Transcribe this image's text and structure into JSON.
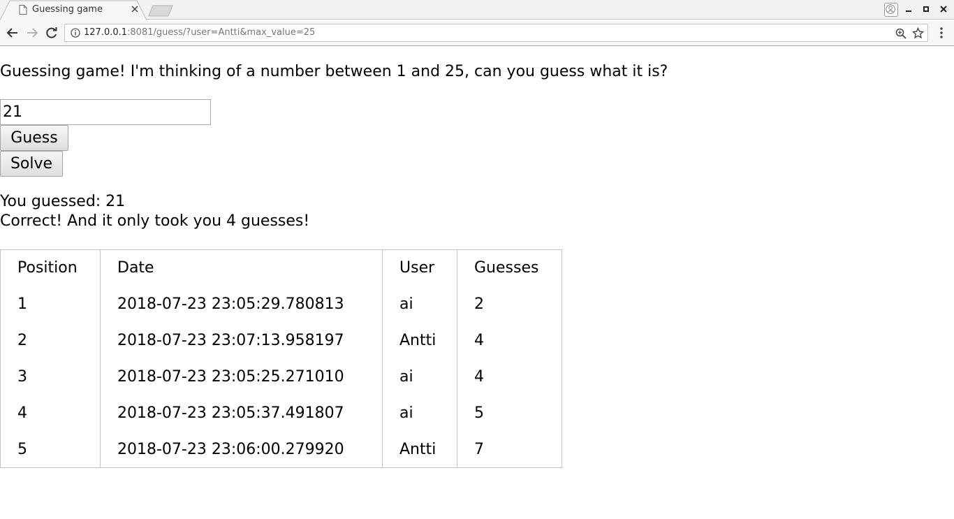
{
  "browser": {
    "tab_title": "Guessing game",
    "url_host": "127.0.0.1",
    "url_rest": ":8081/guess/?user=Antti&max_value=25",
    "icons": [
      "page-icon",
      "close-icon",
      "new-tab-icon",
      "profile-icon",
      "minimize-icon",
      "maximize-icon",
      "window-close-icon",
      "back-icon",
      "forward-icon",
      "reload-icon",
      "info-icon",
      "zoom-icon",
      "star-icon",
      "menu-icon"
    ]
  },
  "page": {
    "intro": "Guessing game! I'm thinking of a number between 1 and 25, can you guess what it is?",
    "input_value": "21",
    "guess_label": "Guess",
    "solve_label": "Solve",
    "result_line1": "You guessed: 21",
    "result_line2": "Correct! And it only took you 4 guesses!"
  },
  "table": {
    "headers": [
      "Position",
      "Date",
      "User",
      "Guesses"
    ],
    "rows": [
      [
        "1",
        "2018-07-23 23:05:29.780813",
        "ai",
        "2"
      ],
      [
        "2",
        "2018-07-23 23:07:13.958197",
        "Antti",
        "4"
      ],
      [
        "3",
        "2018-07-23 23:05:25.271010",
        "ai",
        "4"
      ],
      [
        "4",
        "2018-07-23 23:05:37.491807",
        "ai",
        "5"
      ],
      [
        "5",
        "2018-07-23 23:06:00.279920",
        "Antti",
        "7"
      ]
    ]
  }
}
